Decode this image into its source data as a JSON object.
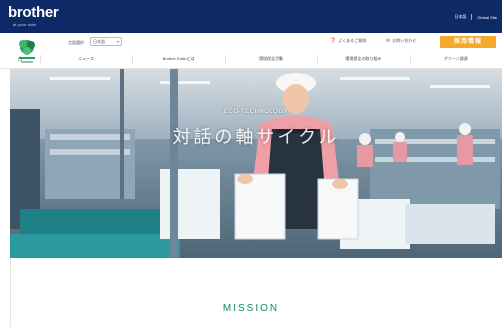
{
  "brand": {
    "logo_text": "brother",
    "tagline": "at your side"
  },
  "global_links": [
    "日本語",
    "Global Site"
  ],
  "subheader": {
    "language_label": "言語選択",
    "language_value": "日本語",
    "faq_label": "よくあるご質問",
    "contact_label": "お問い合わせ",
    "recruit_label": "採用情報"
  },
  "nav": {
    "items": [
      "ニュース",
      "Brother Earthとは",
      "環境保全活動",
      "環境保全の取り組み",
      "グリーン調達"
    ]
  },
  "hero": {
    "kicker": "ECO-TECHNOLOGY",
    "title": "対話の軸サイクル"
  },
  "section": {
    "mission_heading": "MISSION"
  },
  "colors": {
    "brand_navy": "#0d2a66",
    "accent_orange": "#f4a92c",
    "accent_green": "#0e8a6a"
  }
}
